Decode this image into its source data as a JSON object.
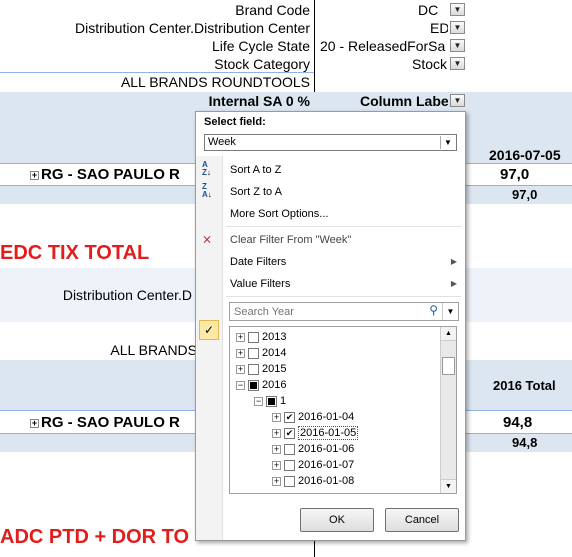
{
  "sheet": {
    "filter_rows": [
      {
        "label": "Brand Code",
        "value": "DC"
      },
      {
        "label": "Distribution Center.Distribution Center",
        "value": "ED"
      },
      {
        "label": "Life Cycle State",
        "value": "20  - ReleasedForSa"
      },
      {
        "label": "Stock Category",
        "value": "Stock"
      }
    ],
    "all_brands_1": "ALL BRANDS ROUNDTOOLS",
    "internal_sa": "Internal SA 0 %",
    "column_labels": "Column Labe",
    "date_header": "2016-07-05",
    "rg_row_1": "RG - SAO PAULO R",
    "rg_val_1": "97,0",
    "rg_sub_1": "97,0",
    "section2_title": "EDC TIX TOTAL",
    "dist_center_2": "Distribution Center.D",
    "all_brands_2": "ALL BRANDS",
    "total_header_2": "2016 Total",
    "rg_row_2": "RG - SAO PAULO R",
    "rg_val_2": "94,8",
    "rg_sub_2": "94,8",
    "section3_title": "ADC PTD + DOR TO"
  },
  "popup": {
    "select_field_label": "Select field:",
    "field_value": "Week",
    "menu": {
      "sort_az": "Sort A to Z",
      "sort_za": "Sort Z to A",
      "more_sort": "More Sort Options...",
      "clear_filter": "Clear Filter From \"Week\"",
      "date_filters": "Date Filters",
      "value_filters": "Value Filters"
    },
    "search_placeholder": "Search Year",
    "tree": [
      {
        "label": "2013",
        "exp": "+",
        "check": "none",
        "level": 0
      },
      {
        "label": "2014",
        "exp": "+",
        "check": "none",
        "level": 0
      },
      {
        "label": "2015",
        "exp": "+",
        "check": "none",
        "level": 0
      },
      {
        "label": "2016",
        "exp": "−",
        "check": "partial",
        "level": 0
      },
      {
        "label": "1",
        "exp": "−",
        "check": "partial",
        "level": 1
      },
      {
        "label": "2016-01-04",
        "exp": "+",
        "check": "checked",
        "level": 2
      },
      {
        "label": "2016-01-05",
        "exp": "+",
        "check": "checked",
        "level": 2
      },
      {
        "label": "2016-01-06",
        "exp": "+",
        "check": "none",
        "level": 2
      },
      {
        "label": "2016-01-07",
        "exp": "+",
        "check": "none",
        "level": 2
      },
      {
        "label": "2016-01-08",
        "exp": "+",
        "check": "none",
        "level": 2
      }
    ],
    "ok_label": "OK",
    "cancel_label": "Cancel"
  }
}
